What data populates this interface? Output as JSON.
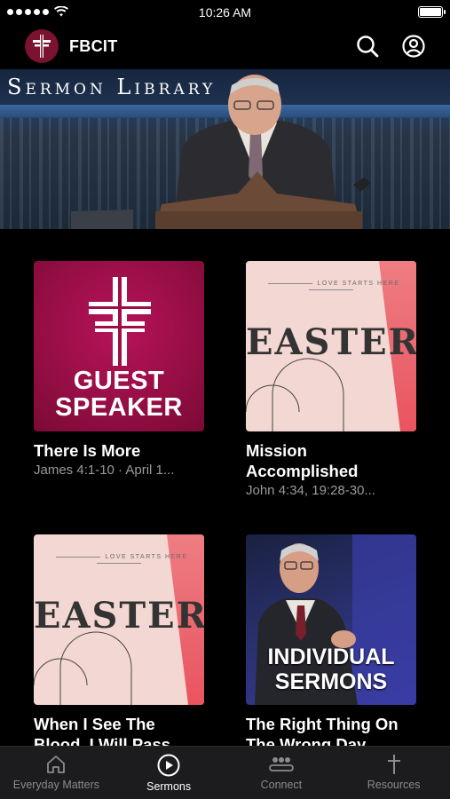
{
  "status": {
    "time": "10:26 AM"
  },
  "header": {
    "title": "FBCIT"
  },
  "hero": {
    "title": "Sermon Library"
  },
  "cards": [
    {
      "title": "There Is More",
      "subtitle": "James 4:1-10 · April 1...",
      "art": {
        "line1": "GUEST",
        "line2": "SPEAKER"
      }
    },
    {
      "title": "Mission Accomplished",
      "subtitle": "John 4:34, 19:28-30...",
      "art": {
        "tagline": "LOVE STARTS HERE",
        "word": "EASTER"
      }
    },
    {
      "title": "When I See The Blood, I Will Pass",
      "subtitle": "",
      "art": {
        "tagline": "LOVE STARTS HERE",
        "word": "EASTER"
      }
    },
    {
      "title": "The Right Thing On The Wrong Day",
      "subtitle": "",
      "art": {
        "line1": "INDIVIDUAL",
        "line2": "SERMONS"
      }
    }
  ],
  "tabs": [
    {
      "label": "Everyday Matters",
      "icon": "home-icon",
      "active": false
    },
    {
      "label": "Sermons",
      "icon": "play-icon",
      "active": true
    },
    {
      "label": "Connect",
      "icon": "people-icon",
      "active": false
    },
    {
      "label": "Resources",
      "icon": "cross-icon",
      "active": false
    }
  ],
  "colors": {
    "brand": "#7a1230",
    "guest_bg": "#a0104c",
    "easter_bg": "#f3d7d2",
    "accent_stripe": "#ea5a63",
    "tabbar_bg": "#1c1c1e"
  }
}
